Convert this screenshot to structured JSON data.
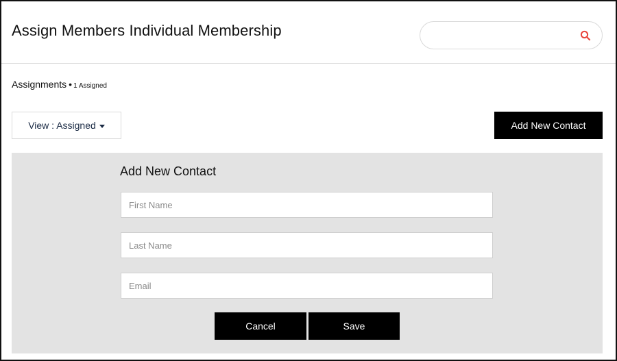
{
  "header": {
    "title": "Assign Members Individual Membership",
    "search": {
      "value": "",
      "placeholder": ""
    }
  },
  "assignments": {
    "label": "Assignments",
    "separator": "•",
    "count_text": "1 Assigned"
  },
  "toolbar": {
    "view_label": "View : Assigned",
    "add_contact_label": "Add New Contact"
  },
  "form": {
    "title": "Add New Contact",
    "first_name": {
      "value": "",
      "placeholder": "First Name"
    },
    "last_name": {
      "value": "",
      "placeholder": "Last Name"
    },
    "email": {
      "value": "",
      "placeholder": "Email"
    },
    "cancel_label": "Cancel",
    "save_label": "Save"
  },
  "colors": {
    "accent_search_icon": "#e8453c",
    "button_bg": "#000000",
    "panel_bg": "#e3e3e3"
  }
}
